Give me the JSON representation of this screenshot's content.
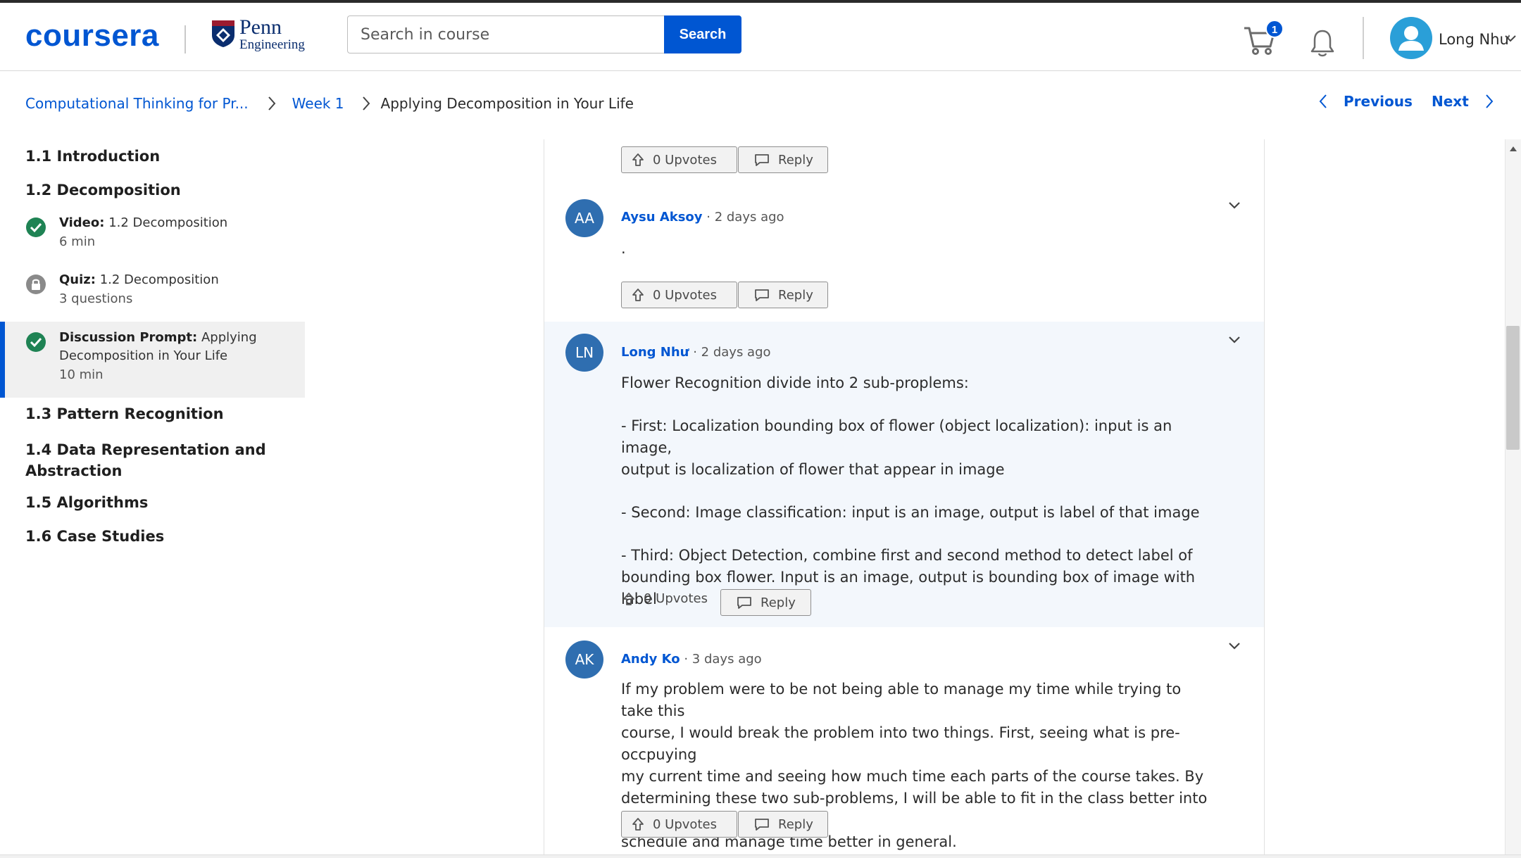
{
  "header": {
    "logo": "coursera",
    "partner_line1": "Penn",
    "partner_line2": "Engineering",
    "search_placeholder": "Search in course",
    "search_button": "Search",
    "cart_count": "1",
    "user_name": "Long Như",
    "accent_color": "#0056d2"
  },
  "breadcrumb": {
    "course": "Computational Thinking for Pr...",
    "week": "Week 1",
    "current": "Applying Decomposition in Your Life"
  },
  "pager": {
    "previous": "Previous",
    "next": "Next"
  },
  "sidebar": {
    "sections": [
      "1.1 Introduction",
      "1.2 Decomposition",
      "1.3 Pattern Recognition",
      "1.4 Data Representation and",
      "Abstraction",
      "1.5 Algorithms",
      "1.6 Case Studies"
    ],
    "lessons": [
      {
        "type": "Video:",
        "title": "1.2 Decomposition",
        "meta": "6 min",
        "status": "check-circle-icon"
      },
      {
        "type": "Quiz:",
        "title": "1.2 Decomposition",
        "meta": "3 questions",
        "status": "lock-icon"
      },
      {
        "type": "Discussion Prompt:",
        "title_line1": "Applying",
        "title_line2": "Decomposition in Your Life",
        "meta": "10 min",
        "status": "check-circle-icon"
      }
    ]
  },
  "posts": [
    {
      "upvotes": "0 Upvotes",
      "reply": "Reply"
    },
    {
      "initials": "AA",
      "author": "Aysu Aksoy",
      "time": " · 2 days ago",
      "body": ".",
      "upvotes": "0 Upvotes",
      "reply": "Reply"
    },
    {
      "initials": "LN",
      "author": "Long Như",
      "time": " · 2 days ago",
      "body": [
        "Flower Recognition divide into 2 sub-proplems:",
        " - First: Localization bounding box of flower (object localization): input is an image,",
        "output is localization of flower that appear in image",
        " - Second: Image classification: input is an image, output is label of that image",
        "- Third: Object Detection, combine first and second method to detect label of",
        "bounding box flower. Input is an image, output is bounding box of image with label"
      ],
      "upvotes": "0 Upvotes",
      "reply": "Reply"
    },
    {
      "initials": "AK",
      "author": "Andy Ko",
      "time": " · 3 days ago",
      "body": [
        "If my problem were to be not being able to manage my time while trying to take this",
        "course, I would break the problem into two things. First, seeing what is pre-occpuying",
        "my current time and seeing how much time each parts of the course takes. By",
        "determining these two sub-problems, I will be able to fit in the class better into my",
        "schedule and manage time better in general."
      ],
      "upvotes": "0 Upvotes",
      "reply": "Reply"
    }
  ]
}
